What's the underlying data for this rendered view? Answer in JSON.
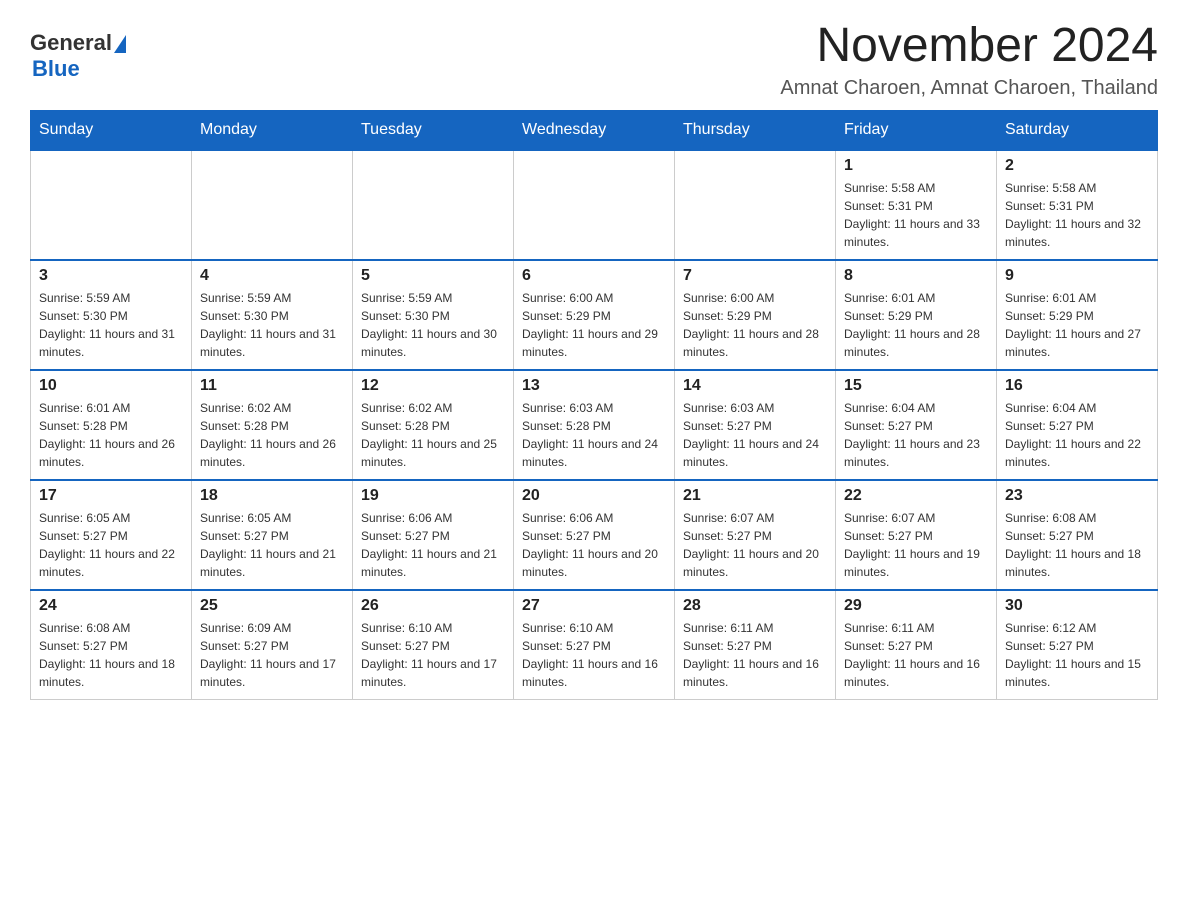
{
  "header": {
    "logo_general": "General",
    "logo_blue": "Blue",
    "title": "November 2024",
    "subtitle": "Amnat Charoen, Amnat Charoen, Thailand"
  },
  "calendar": {
    "days_of_week": [
      "Sunday",
      "Monday",
      "Tuesday",
      "Wednesday",
      "Thursday",
      "Friday",
      "Saturday"
    ],
    "weeks": [
      [
        {
          "day": "",
          "info": ""
        },
        {
          "day": "",
          "info": ""
        },
        {
          "day": "",
          "info": ""
        },
        {
          "day": "",
          "info": ""
        },
        {
          "day": "",
          "info": ""
        },
        {
          "day": "1",
          "info": "Sunrise: 5:58 AM\nSunset: 5:31 PM\nDaylight: 11 hours and 33 minutes."
        },
        {
          "day": "2",
          "info": "Sunrise: 5:58 AM\nSunset: 5:31 PM\nDaylight: 11 hours and 32 minutes."
        }
      ],
      [
        {
          "day": "3",
          "info": "Sunrise: 5:59 AM\nSunset: 5:30 PM\nDaylight: 11 hours and 31 minutes."
        },
        {
          "day": "4",
          "info": "Sunrise: 5:59 AM\nSunset: 5:30 PM\nDaylight: 11 hours and 31 minutes."
        },
        {
          "day": "5",
          "info": "Sunrise: 5:59 AM\nSunset: 5:30 PM\nDaylight: 11 hours and 30 minutes."
        },
        {
          "day": "6",
          "info": "Sunrise: 6:00 AM\nSunset: 5:29 PM\nDaylight: 11 hours and 29 minutes."
        },
        {
          "day": "7",
          "info": "Sunrise: 6:00 AM\nSunset: 5:29 PM\nDaylight: 11 hours and 28 minutes."
        },
        {
          "day": "8",
          "info": "Sunrise: 6:01 AM\nSunset: 5:29 PM\nDaylight: 11 hours and 28 minutes."
        },
        {
          "day": "9",
          "info": "Sunrise: 6:01 AM\nSunset: 5:29 PM\nDaylight: 11 hours and 27 minutes."
        }
      ],
      [
        {
          "day": "10",
          "info": "Sunrise: 6:01 AM\nSunset: 5:28 PM\nDaylight: 11 hours and 26 minutes."
        },
        {
          "day": "11",
          "info": "Sunrise: 6:02 AM\nSunset: 5:28 PM\nDaylight: 11 hours and 26 minutes."
        },
        {
          "day": "12",
          "info": "Sunrise: 6:02 AM\nSunset: 5:28 PM\nDaylight: 11 hours and 25 minutes."
        },
        {
          "day": "13",
          "info": "Sunrise: 6:03 AM\nSunset: 5:28 PM\nDaylight: 11 hours and 24 minutes."
        },
        {
          "day": "14",
          "info": "Sunrise: 6:03 AM\nSunset: 5:27 PM\nDaylight: 11 hours and 24 minutes."
        },
        {
          "day": "15",
          "info": "Sunrise: 6:04 AM\nSunset: 5:27 PM\nDaylight: 11 hours and 23 minutes."
        },
        {
          "day": "16",
          "info": "Sunrise: 6:04 AM\nSunset: 5:27 PM\nDaylight: 11 hours and 22 minutes."
        }
      ],
      [
        {
          "day": "17",
          "info": "Sunrise: 6:05 AM\nSunset: 5:27 PM\nDaylight: 11 hours and 22 minutes."
        },
        {
          "day": "18",
          "info": "Sunrise: 6:05 AM\nSunset: 5:27 PM\nDaylight: 11 hours and 21 minutes."
        },
        {
          "day": "19",
          "info": "Sunrise: 6:06 AM\nSunset: 5:27 PM\nDaylight: 11 hours and 21 minutes."
        },
        {
          "day": "20",
          "info": "Sunrise: 6:06 AM\nSunset: 5:27 PM\nDaylight: 11 hours and 20 minutes."
        },
        {
          "day": "21",
          "info": "Sunrise: 6:07 AM\nSunset: 5:27 PM\nDaylight: 11 hours and 20 minutes."
        },
        {
          "day": "22",
          "info": "Sunrise: 6:07 AM\nSunset: 5:27 PM\nDaylight: 11 hours and 19 minutes."
        },
        {
          "day": "23",
          "info": "Sunrise: 6:08 AM\nSunset: 5:27 PM\nDaylight: 11 hours and 18 minutes."
        }
      ],
      [
        {
          "day": "24",
          "info": "Sunrise: 6:08 AM\nSunset: 5:27 PM\nDaylight: 11 hours and 18 minutes."
        },
        {
          "day": "25",
          "info": "Sunrise: 6:09 AM\nSunset: 5:27 PM\nDaylight: 11 hours and 17 minutes."
        },
        {
          "day": "26",
          "info": "Sunrise: 6:10 AM\nSunset: 5:27 PM\nDaylight: 11 hours and 17 minutes."
        },
        {
          "day": "27",
          "info": "Sunrise: 6:10 AM\nSunset: 5:27 PM\nDaylight: 11 hours and 16 minutes."
        },
        {
          "day": "28",
          "info": "Sunrise: 6:11 AM\nSunset: 5:27 PM\nDaylight: 11 hours and 16 minutes."
        },
        {
          "day": "29",
          "info": "Sunrise: 6:11 AM\nSunset: 5:27 PM\nDaylight: 11 hours and 16 minutes."
        },
        {
          "day": "30",
          "info": "Sunrise: 6:12 AM\nSunset: 5:27 PM\nDaylight: 11 hours and 15 minutes."
        }
      ]
    ]
  }
}
